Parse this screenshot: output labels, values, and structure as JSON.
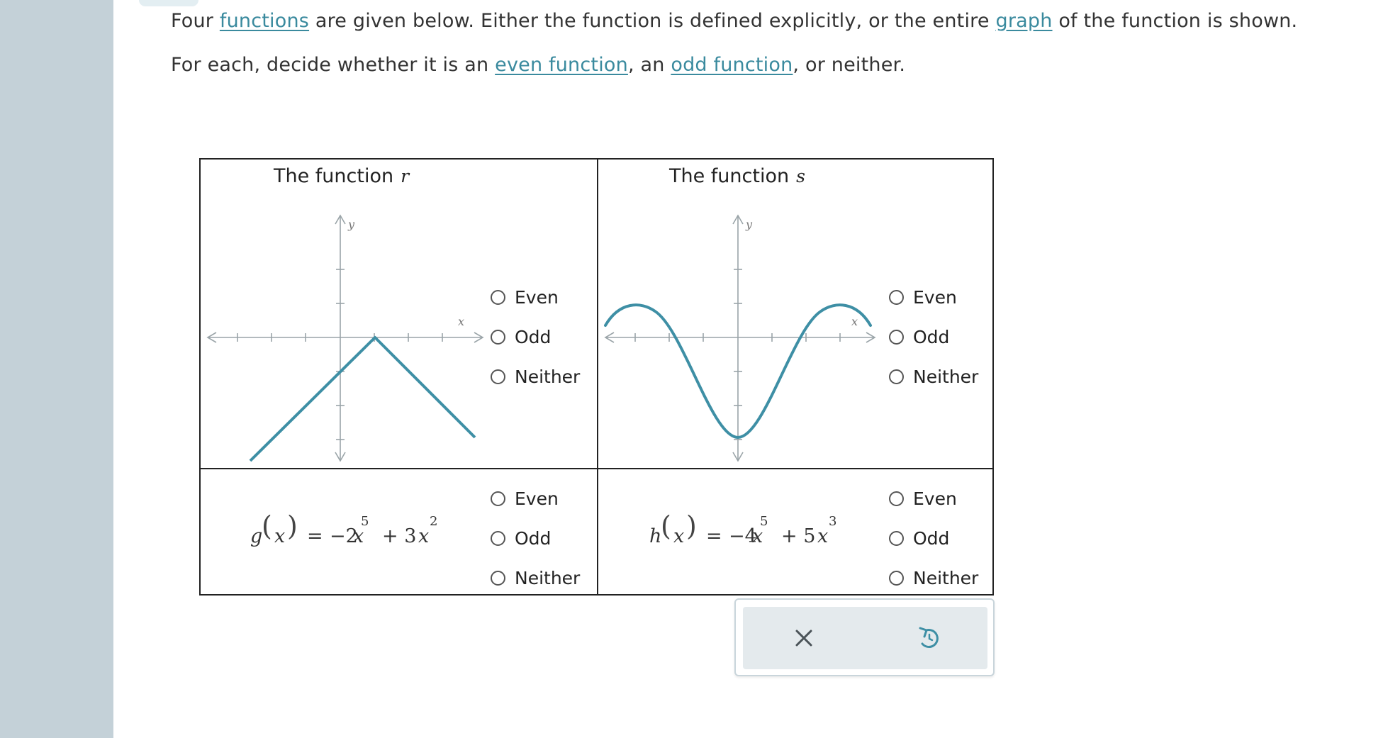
{
  "intro": {
    "line1": {
      "t1": "Four ",
      "l1": "functions",
      "t2": " are given below. Either the function is defined explicitly, or the entire ",
      "l2": "graph",
      "t3": " of the function is shown."
    },
    "line2": {
      "t1": "For each, decide whether it is an ",
      "l1": "even function",
      "t2": ", an ",
      "l2": "odd function",
      "t3": ", or neither."
    }
  },
  "options": [
    "Even",
    "Odd",
    "Neither"
  ],
  "cells": {
    "r": {
      "title": "The function",
      "var": "r",
      "xlabel": "x",
      "ylabel": "y"
    },
    "s": {
      "title": "The function",
      "var": "s",
      "xlabel": "x",
      "ylabel": "y"
    },
    "g": {
      "name": "g",
      "arg": "x",
      "eq": "=",
      "c1": "−2",
      "v1": "x",
      "e1": "5",
      "op": "+ 3",
      "v2": "x",
      "e2": "2"
    },
    "h": {
      "name": "h",
      "arg": "x",
      "eq": "=",
      "c1": "−4",
      "v1": "x",
      "e1": "5",
      "op": "+ 5",
      "v2": "x",
      "e2": "3"
    }
  },
  "toolbar": {
    "clear_icon": "x-icon",
    "undo_icon": "undo-icon"
  },
  "colors": {
    "accent": "#3a8a9e",
    "curve": "#3e8fa5",
    "axis": "#9aa4a8",
    "sidebar": "#c4d1d8",
    "toolbar": "#e4eaed"
  }
}
